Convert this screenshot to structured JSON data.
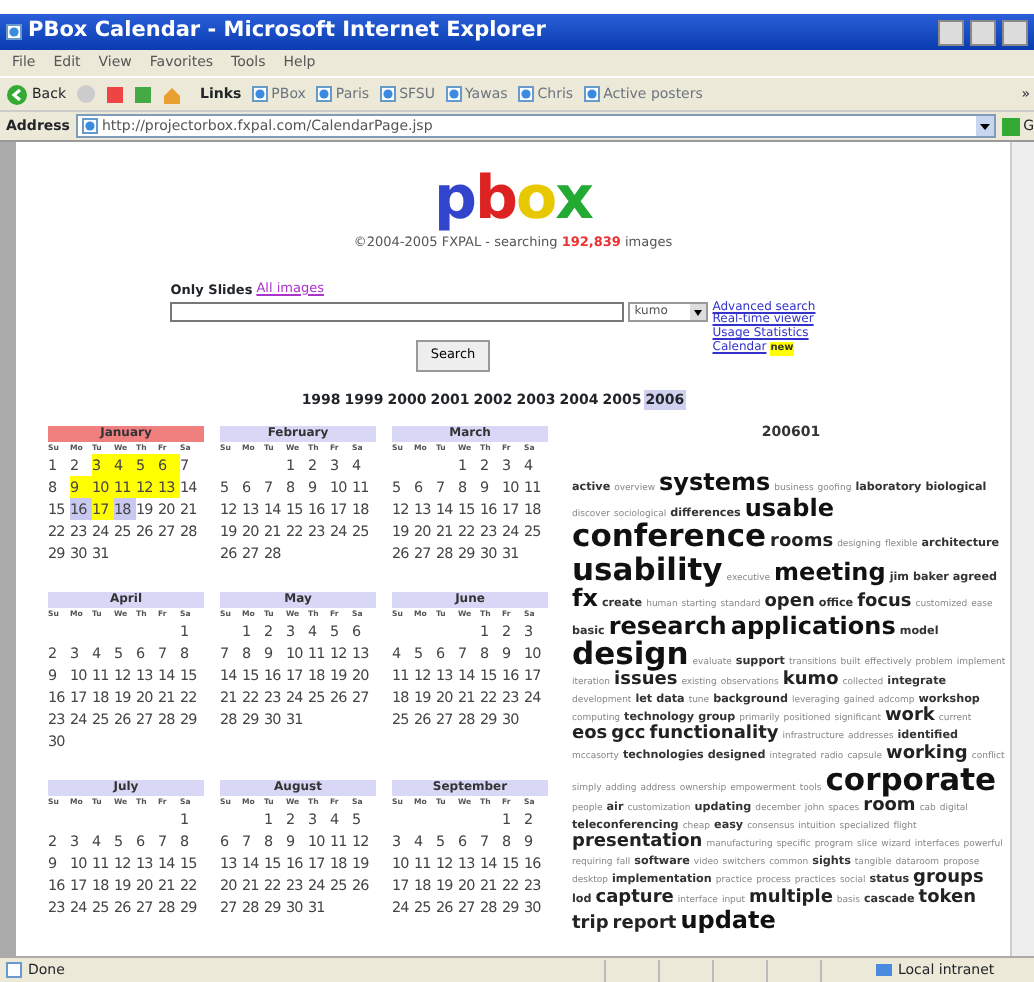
{
  "window": {
    "title": "PBox Calendar - Microsoft Internet Explorer"
  },
  "menu": [
    "File",
    "Edit",
    "View",
    "Favorites",
    "Tools",
    "Help"
  ],
  "toolbar": {
    "back": "Back",
    "links_label": "Links",
    "links": [
      "PBox",
      "Paris",
      "SFSU",
      "Yawas",
      "Chris",
      "Active posters"
    ],
    "more": "»"
  },
  "address": {
    "label": "Address",
    "url": "http://projectorbox.fxpal.com/CalendarPage.jsp",
    "go": "G"
  },
  "logo": [
    "p",
    "b",
    "o",
    "x"
  ],
  "tagline": {
    "before": "©2004-2005 FXPAL - searching",
    "count": "192,839",
    "after": "images"
  },
  "filters": [
    {
      "label": "Only Slides",
      "selected": true
    },
    {
      "label": "All images",
      "selected": false
    }
  ],
  "search": {
    "scope": "kumo",
    "button": "Search"
  },
  "side_links": [
    {
      "label": "Advanced search"
    },
    {
      "label": "Real-time viewer"
    },
    {
      "label": "Usage Statistics"
    },
    {
      "label": "Calendar",
      "badge": "new"
    }
  ],
  "years": [
    {
      "label": "1998",
      "selected": false
    },
    {
      "label": "1999",
      "selected": false
    },
    {
      "label": "2000",
      "selected": false
    },
    {
      "label": "2001",
      "selected": false
    },
    {
      "label": "2002",
      "selected": false
    },
    {
      "label": "2003",
      "selected": false
    },
    {
      "label": "2004",
      "selected": false
    },
    {
      "label": "2005",
      "selected": false
    },
    {
      "label": "2006",
      "selected": true
    }
  ],
  "months": [
    {
      "weekdays": [
        "Su",
        "Mo",
        "Tu",
        "We",
        "Th",
        "Fr",
        "Sa"
      ],
      "name": "January",
      "selected": true,
      "weeks": [
        [
          "1",
          "2",
          {
            "d": "3",
            "color": "#ffff00"
          },
          {
            "d": "4",
            "color": "#ffff00"
          },
          {
            "d": "5",
            "color": "#ffff00"
          },
          {
            "d": "6",
            "color": "#ffff00"
          },
          "7"
        ],
        [
          "8",
          {
            "d": "9",
            "color": "#ffff00"
          },
          {
            "d": "10",
            "color": "#ffff00"
          },
          {
            "d": "11",
            "color": "#ffff00"
          },
          {
            "d": "12",
            "color": "#ffff00"
          },
          {
            "d": "13",
            "color": "#ffff00"
          },
          "14"
        ],
        [
          "15",
          {
            "d": "16",
            "color": "#c8c8f0"
          },
          {
            "d": "17",
            "color": "#ffff00"
          },
          {
            "d": "18",
            "color": "#c8c8f0"
          },
          "19",
          "20",
          "21"
        ],
        [
          "22",
          "23",
          "24",
          "25",
          "26",
          "27",
          "28"
        ],
        [
          "29",
          "30",
          "31"
        ]
      ]
    },
    {
      "weekdays": [
        "Su",
        "Mo",
        "Tu",
        "We",
        "Th",
        "Fr",
        "Sa"
      ],
      "name": "February",
      "selected": false,
      "weeks": [
        "1 2 3 4",
        "5 6 7 8 9 10 11",
        "12 13 14 15 16 17 18",
        "19 20 21 22 23 24 25",
        "26 27 28"
      ]
    },
    {
      "weekdays": [
        "Su",
        "Mo",
        "Tu",
        "We",
        "Th",
        "Fr",
        "Sa"
      ],
      "name": "March",
      "selected": false,
      "weeks": [
        "1 2 3 4",
        "5 6 7 8 9 10 11",
        "12 13 14 15 16 17 18",
        "19 20 21 22 23 24 25",
        "26 27 28 29 30 31"
      ]
    },
    {
      "weekdays": [
        "Su",
        "Mo",
        "Tu",
        "We",
        "Th",
        "Fr",
        "Sa"
      ],
      "name": "April",
      "selected": false,
      "weeks": [
        "1",
        "2 3 4 5 6 7 8",
        "9 10 11 12 13 14 15",
        "16 17 18 19 20 21 22",
        "23 24 25 26 27 28 29",
        "30"
      ]
    },
    {
      "weekdays": [
        "Su",
        "Mo",
        "Tu",
        "We",
        "Th",
        "Fr",
        "Sa"
      ],
      "name": "May",
      "selected": false,
      "weeks": [
        "1 2 3 4 5 6",
        "7 8 9 10 11 12 13",
        "14 15 16 17 18 19 20",
        "21 22 23 24 25 26 27",
        "28 29 30 31"
      ]
    },
    {
      "weekdays": [
        "Su",
        "Mo",
        "Tu",
        "We",
        "Th",
        "Fr",
        "Sa"
      ],
      "name": "June",
      "selected": false,
      "weeks": [
        "1 2 3",
        "4 5 6 7 8 9 10",
        "11 12 13 14 15 16 17",
        "18 19 20 21 22 23 24",
        "25 26 27 28 29 30"
      ]
    },
    {
      "weekdays": [
        "Su",
        "Mo",
        "Tu",
        "We",
        "Th",
        "Fr",
        "Sa"
      ],
      "name": "July",
      "selected": false,
      "weeks": [
        "1",
        "2 3 4 5 6 7 8",
        "9 10 11 12 13 14 15",
        "16 17 18 19 20 21 22",
        "23 24 25 26 27 28 29"
      ]
    },
    {
      "weekdays": [
        "Su",
        "Mo",
        "Tu",
        "We",
        "Th",
        "Fr",
        "Sa"
      ],
      "name": "August",
      "selected": false,
      "weeks": [
        "1 2 3 4 5",
        "6 7 8 9 10 11 12",
        "13 14 15 16 17 18 19",
        "20 21 22 23 24 25 26",
        "27 28 29 30 31"
      ]
    },
    {
      "weekdays": [
        "Su",
        "Mo",
        "Tu",
        "We",
        "Th",
        "Fr",
        "Sa"
      ],
      "name": "September",
      "selected": false,
      "weeks": [
        "1 2",
        "3 4 5 6 7 8 9",
        "10 11 12 13 14 15 16",
        "17 18 19 20 21 22 23",
        "24 25 26 27 28 29 30"
      ]
    }
  ],
  "cloud": {
    "heading": "200601",
    "tags": [
      {
        "text": "active",
        "kind": "s2"
      },
      {
        "text": "overview",
        "kind": "s1"
      },
      {
        "text": "systems",
        "kind": "s4"
      },
      {
        "text": "business",
        "kind": "s1"
      },
      {
        "text": "goofing",
        "kind": "s1"
      },
      {
        "text": "laboratory",
        "kind": "s2"
      },
      {
        "text": "biological",
        "kind": "s2"
      },
      {
        "text": "discover",
        "kind": "s1"
      },
      {
        "text": "sociological",
        "kind": "s1"
      },
      {
        "text": "differences",
        "kind": "s2"
      },
      {
        "text": "usable",
        "kind": "s4"
      },
      {
        "text": "conference",
        "kind": "s5"
      },
      {
        "text": "rooms",
        "kind": "s3"
      },
      {
        "text": "designing",
        "kind": "s1"
      },
      {
        "text": "flexible",
        "kind": "s1"
      },
      {
        "text": "architecture",
        "kind": "s2"
      },
      {
        "text": "usability",
        "kind": "s5"
      },
      {
        "text": "executive",
        "kind": "s1"
      },
      {
        "text": "meeting",
        "kind": "s4"
      },
      {
        "text": "jim",
        "kind": "s2"
      },
      {
        "text": "baker",
        "kind": "s2"
      },
      {
        "text": "agreed",
        "kind": "s2"
      },
      {
        "text": "fx",
        "kind": "s4"
      },
      {
        "text": "create",
        "kind": "s2"
      },
      {
        "text": "human",
        "kind": "s1"
      },
      {
        "text": "starting",
        "kind": "s1"
      },
      {
        "text": "standard",
        "kind": "s1"
      },
      {
        "text": "open",
        "kind": "s3"
      },
      {
        "text": "office",
        "kind": "s2"
      },
      {
        "text": "focus",
        "kind": "s3"
      },
      {
        "text": "customized",
        "kind": "s1"
      },
      {
        "text": "ease",
        "kind": "s1"
      },
      {
        "text": "basic",
        "kind": "s2"
      },
      {
        "text": "research",
        "kind": "s4"
      },
      {
        "text": "applications",
        "kind": "s4"
      },
      {
        "text": "model",
        "kind": "s2"
      },
      {
        "text": "design",
        "kind": "s5"
      },
      {
        "text": "evaluate",
        "kind": "s1"
      },
      {
        "text": "support",
        "kind": "s2"
      },
      {
        "text": "transitions",
        "kind": "s1"
      },
      {
        "text": "built",
        "kind": "s1"
      },
      {
        "text": "effectively",
        "kind": "s1"
      },
      {
        "text": "problem",
        "kind": "s1"
      },
      {
        "text": "implement",
        "kind": "s1"
      },
      {
        "text": "iteration",
        "kind": "s1"
      },
      {
        "text": "issues",
        "kind": "s3"
      },
      {
        "text": "existing",
        "kind": "s1"
      },
      {
        "text": "observations",
        "kind": "s1"
      },
      {
        "text": "kumo",
        "kind": "s3"
      },
      {
        "text": "collected",
        "kind": "s1"
      },
      {
        "text": "integrate",
        "kind": "s2"
      },
      {
        "text": "development",
        "kind": "s1"
      },
      {
        "text": "let",
        "kind": "s2"
      },
      {
        "text": "data",
        "kind": "s2"
      },
      {
        "text": "tune",
        "kind": "s1"
      },
      {
        "text": "background",
        "kind": "s2"
      },
      {
        "text": "leveraging",
        "kind": "s1"
      },
      {
        "text": "gained",
        "kind": "s1"
      },
      {
        "text": "adcomp",
        "kind": "s1"
      },
      {
        "text": "workshop",
        "kind": "s2"
      },
      {
        "text": "computing",
        "kind": "s1"
      },
      {
        "text": "technology",
        "kind": "s2"
      },
      {
        "text": "group",
        "kind": "s2"
      },
      {
        "text": "primarily",
        "kind": "s1"
      },
      {
        "text": "positioned",
        "kind": "s1"
      },
      {
        "text": "significant",
        "kind": "s1"
      },
      {
        "text": "work",
        "kind": "s3"
      },
      {
        "text": "current",
        "kind": "s1"
      },
      {
        "text": "eos",
        "kind": "s3"
      },
      {
        "text": "gcc",
        "kind": "s3"
      },
      {
        "text": "functionality",
        "kind": "s3"
      },
      {
        "text": "infrastructure",
        "kind": "s1"
      },
      {
        "text": "addresses",
        "kind": "s1"
      },
      {
        "text": "identified",
        "kind": "s2"
      },
      {
        "text": "mccasorty",
        "kind": "s1"
      },
      {
        "text": "technologies",
        "kind": "s2"
      },
      {
        "text": "designed",
        "kind": "s2"
      },
      {
        "text": "integrated",
        "kind": "s1"
      },
      {
        "text": "radio",
        "kind": "s1"
      },
      {
        "text": "capsule",
        "kind": "s1"
      },
      {
        "text": "working",
        "kind": "s3"
      },
      {
        "text": "conflict",
        "kind": "s1"
      },
      {
        "text": "simply",
        "kind": "s1"
      },
      {
        "text": "adding",
        "kind": "s1"
      },
      {
        "text": "address",
        "kind": "s1"
      },
      {
        "text": "ownership",
        "kind": "s1"
      },
      {
        "text": "empowerment",
        "kind": "s1"
      },
      {
        "text": "tools",
        "kind": "s1"
      },
      {
        "text": "corporate",
        "kind": "s5"
      },
      {
        "text": "people",
        "kind": "s1"
      },
      {
        "text": "air",
        "kind": "s2"
      },
      {
        "text": "customization",
        "kind": "s1"
      },
      {
        "text": "updating",
        "kind": "s2"
      },
      {
        "text": "december",
        "kind": "s1"
      },
      {
        "text": "john",
        "kind": "s1"
      },
      {
        "text": "spaces",
        "kind": "s1"
      },
      {
        "text": "room",
        "kind": "s3"
      },
      {
        "text": "cab",
        "kind": "s1"
      },
      {
        "text": "digital",
        "kind": "s1"
      },
      {
        "text": "teleconferencing",
        "kind": "s2"
      },
      {
        "text": "cheap",
        "kind": "s1"
      },
      {
        "text": "easy",
        "kind": "s2"
      },
      {
        "text": "consensus",
        "kind": "s1"
      },
      {
        "text": "intuition",
        "kind": "s1"
      },
      {
        "text": "specialized",
        "kind": "s1"
      },
      {
        "text": "flight",
        "kind": "s1"
      },
      {
        "text": "presentation",
        "kind": "s3"
      },
      {
        "text": "manufacturing",
        "kind": "s1"
      },
      {
        "text": "specific",
        "kind": "s1"
      },
      {
        "text": "program",
        "kind": "s1"
      },
      {
        "text": "slice",
        "kind": "s1"
      },
      {
        "text": "wizard",
        "kind": "s1"
      },
      {
        "text": "interfaces",
        "kind": "s1"
      },
      {
        "text": "powerful",
        "kind": "s1"
      },
      {
        "text": "requiring",
        "kind": "s1"
      },
      {
        "text": "fall",
        "kind": "s1"
      },
      {
        "text": "software",
        "kind": "s2"
      },
      {
        "text": "video",
        "kind": "s1"
      },
      {
        "text": "switchers",
        "kind": "s1"
      },
      {
        "text": "common",
        "kind": "s1"
      },
      {
        "text": "sights",
        "kind": "s2"
      },
      {
        "text": "tangible",
        "kind": "s1"
      },
      {
        "text": "dataroom",
        "kind": "s1"
      },
      {
        "text": "propose",
        "kind": "s1"
      },
      {
        "text": "desktop",
        "kind": "s1"
      },
      {
        "text": "implementation",
        "kind": "s2"
      },
      {
        "text": "practice",
        "kind": "s1"
      },
      {
        "text": "process",
        "kind": "s1"
      },
      {
        "text": "practices",
        "kind": "s1"
      },
      {
        "text": "social",
        "kind": "s1"
      },
      {
        "text": "status",
        "kind": "s2"
      },
      {
        "text": "groups",
        "kind": "s3"
      },
      {
        "text": "lod",
        "kind": "s2"
      },
      {
        "text": "capture",
        "kind": "s3"
      },
      {
        "text": "interface",
        "kind": "s1"
      },
      {
        "text": "input",
        "kind": "s1"
      },
      {
        "text": "multiple",
        "kind": "s3"
      },
      {
        "text": "basis",
        "kind": "s1"
      },
      {
        "text": "cascade",
        "kind": "s2"
      },
      {
        "text": "token",
        "kind": "s3"
      },
      {
        "text": "trip",
        "kind": "s3"
      },
      {
        "text": "report",
        "kind": "s3"
      },
      {
        "text": "update",
        "kind": "s4"
      }
    ]
  },
  "status_bar": {
    "text": "Done",
    "zone": "Local intranet"
  }
}
